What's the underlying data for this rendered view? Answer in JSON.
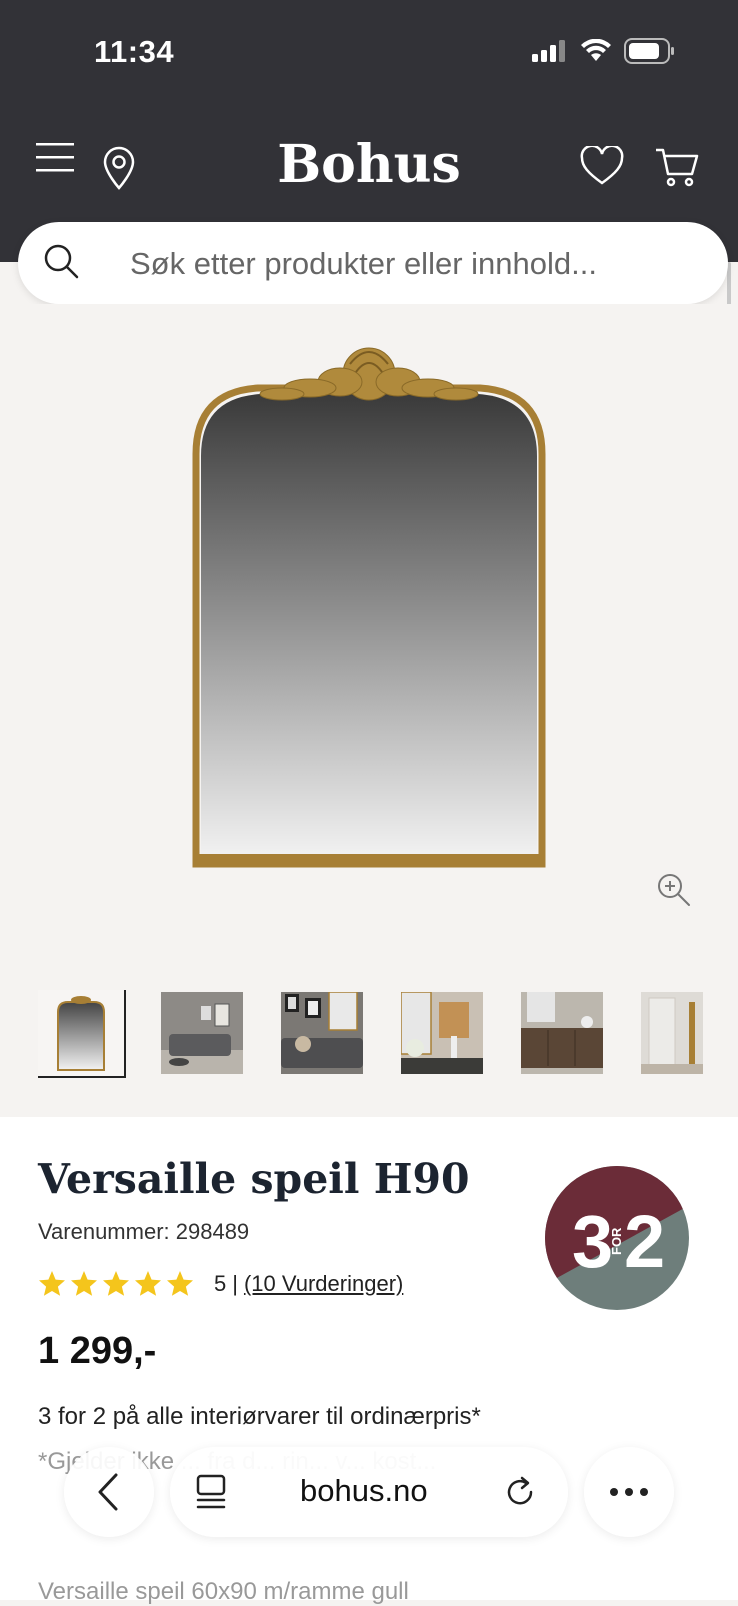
{
  "status_bar": {
    "time": "11:34"
  },
  "header": {
    "logo": "Bohus"
  },
  "search": {
    "placeholder": "Søk etter produkter eller innhold..."
  },
  "product": {
    "title": "Versaille speil H90",
    "sku": "Varenummer: 298489",
    "rating_value": "5",
    "rating_separator": "|",
    "rating_count": "(10 Vurderinger)",
    "rating_stars": 5,
    "price": "1 299,-"
  },
  "badge": {
    "big_left": "3",
    "small": "FOR",
    "big_right": "2"
  },
  "promo": {
    "title": "3 for 2 på alle interiørvarer til ordinærpris*",
    "subtitle": "*Gjelder ikke ... fra d... rin... v... kost..."
  },
  "description_preview": "Versaille speil 60x90 m/ramme gull",
  "browser": {
    "url": "bohus.no"
  },
  "colors": {
    "header_bg": "#323237",
    "star": "#f4c51c",
    "badge_top": "#6b2c38",
    "badge_bottom": "#6e7e7b",
    "frame_gold": "#a77f35"
  },
  "thumbnails": [
    {
      "name": "mirror-front"
    },
    {
      "name": "living-room-grey-sofa"
    },
    {
      "name": "living-room-frames"
    },
    {
      "name": "sideboard-with-vases"
    },
    {
      "name": "wooden-sideboard"
    },
    {
      "name": "mirror-side-view"
    }
  ]
}
